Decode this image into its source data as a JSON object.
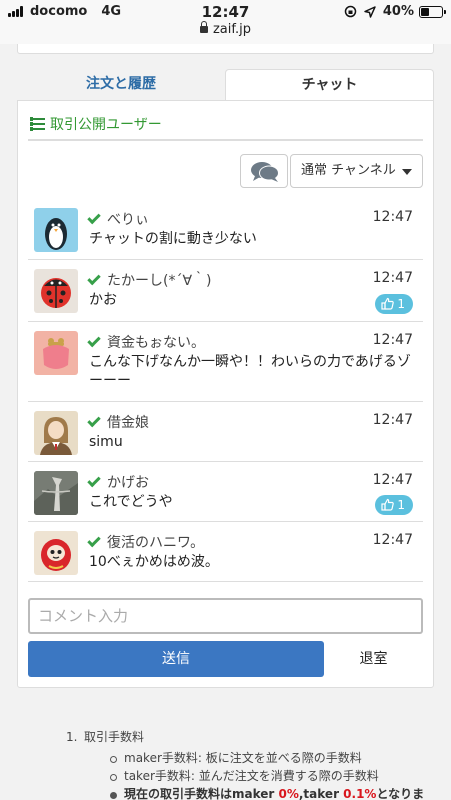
{
  "status": {
    "carrier": "docomo",
    "network": "4G",
    "time": "12:47",
    "url": "zaif.jp",
    "battery": "40%",
    "battery_level": 0.4
  },
  "tabs": {
    "orders": "注文と履歴",
    "chat": "チャット"
  },
  "public_users": "取引公開ユーザー",
  "channel": {
    "selected": "通常 チャンネル"
  },
  "messages": [
    {
      "user": "べりぃ",
      "time": "12:47",
      "text": "チャットの割に動き少ない",
      "likes": ""
    },
    {
      "user": "たかーし(*´∀｀)",
      "time": "12:47",
      "text": "かお",
      "likes": "1"
    },
    {
      "user": "資金もぉない。",
      "time": "12:47",
      "text": "こんな下げなんか一瞬や！！わいらの力であげるゾーーー",
      "likes": ""
    },
    {
      "user": "借金娘",
      "time": "12:47",
      "text": "simu",
      "likes": ""
    },
    {
      "user": "かげお",
      "time": "12:47",
      "text": "これでどうや",
      "likes": "1"
    },
    {
      "user": "復活のハニワ。",
      "time": "12:47",
      "text": "10べぇかめはめ波。",
      "likes": ""
    }
  ],
  "comment": {
    "placeholder": "コメント入力",
    "value": ""
  },
  "buttons": {
    "send": "送信",
    "leave": "退室"
  },
  "fees": {
    "num": "1.",
    "title": "取引手数料",
    "maker": "maker手数料: 板に注文を並べる際の手数料",
    "taker": "taker手数料: 並んだ注文を消費する際の手数料",
    "current_prefix": "現在の取引手数料はmaker ",
    "maker_rate": "0%",
    "mid": ",taker ",
    "taker_rate": "0.1%",
    "suffix": "となりま"
  }
}
